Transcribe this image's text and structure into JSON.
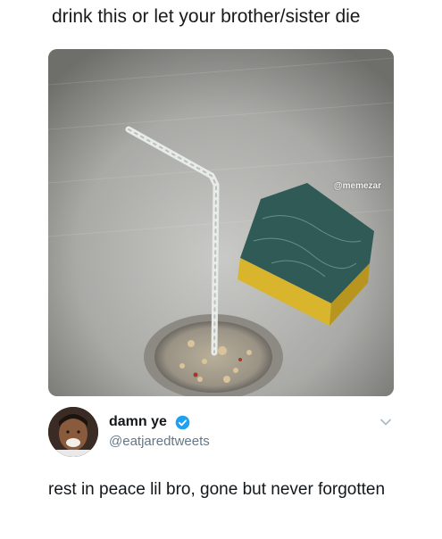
{
  "caption": "drink this or let your brother/sister die",
  "image": {
    "watermark": "@memezar",
    "description_icon": "sink-photo"
  },
  "tweet": {
    "display_name": "damn ye",
    "handle": "@eatjaredtweets",
    "text": "rest in peace lil bro, gone but never forgotten",
    "verified": true,
    "colors": {
      "verified": "#1da1f2",
      "handle": "#657786",
      "text": "#14171a"
    }
  }
}
